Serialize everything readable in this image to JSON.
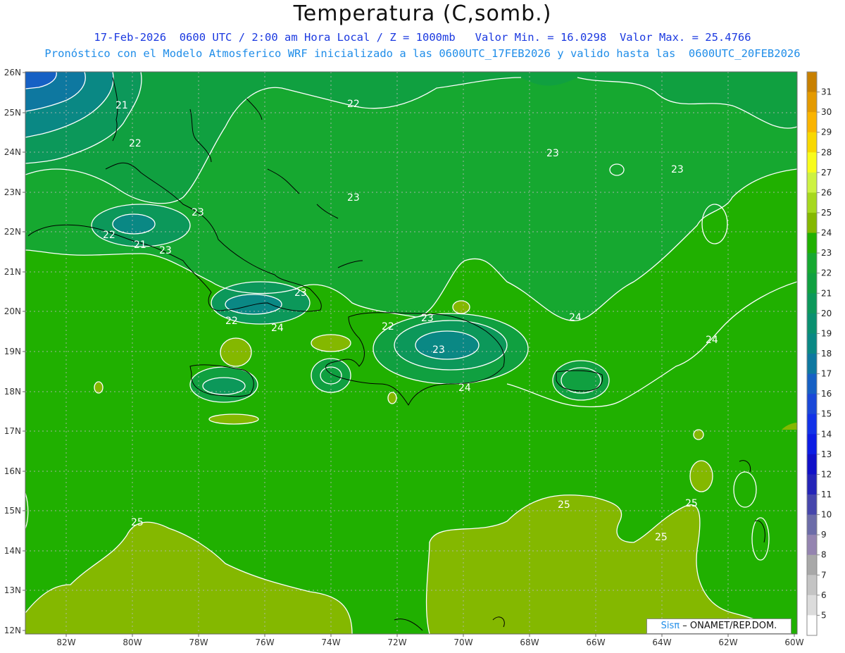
{
  "header": {
    "title": "Temperatura (C,somb.)",
    "line1": "17-Feb-2026  0600 UTC / 2:00 am Hora Local / Z = 1000mb   Valor Min. = 16.0298  Valor Max. = 25.4766",
    "line2": "Pronóstico con el Modelo Atmosferico WRF inicializado a las 0600UTC_17FEB2026 y valido hasta las  0600UTC_20FEB2026"
  },
  "axes": {
    "lat_labels": [
      "26N",
      "25N",
      "24N",
      "23N",
      "22N",
      "21N",
      "20N",
      "19N",
      "18N",
      "17N",
      "16N",
      "15N",
      "14N",
      "13N",
      "12N"
    ],
    "lon_labels": [
      "82W",
      "80W",
      "78W",
      "76W",
      "74W",
      "72W",
      "70W",
      "68W",
      "66W",
      "64W",
      "62W",
      "60W"
    ]
  },
  "colorbar": {
    "levels": [
      "31",
      "30",
      "29",
      "28",
      "27",
      "26",
      "25",
      "24",
      "23",
      "22",
      "21",
      "20",
      "19",
      "18",
      "17",
      "16",
      "15",
      "14",
      "13",
      "12",
      "11",
      "10",
      "9",
      "8",
      "7",
      "6",
      "5"
    ],
    "colors": [
      "#c88000",
      "#e49a00",
      "#fab400",
      "#f8d800",
      "#f8fc1c",
      "#cdf242",
      "#a6d81e",
      "#84b800",
      "#20b000",
      "#16a830",
      "#10a040",
      "#0c985a",
      "#0a9070",
      "#0a8884",
      "#0e78a0",
      "#1660c4",
      "#1a48d8",
      "#1232e8",
      "#0c1ce4",
      "#1010c8",
      "#2424b8",
      "#4646ac",
      "#6c6ca8",
      "#9484b0",
      "#a8a8a8",
      "#c4c4c4",
      "#dcdcdc",
      "#ffffff"
    ]
  },
  "contour_labels": [
    "21",
    "22",
    "22",
    "22",
    "21",
    "23",
    "23",
    "23",
    "23",
    "22",
    "24",
    "22",
    "23",
    "23",
    "24",
    "24",
    "24",
    "23",
    "23",
    "25",
    "25",
    "25",
    "25"
  ],
  "credit": {
    "sis": "Sisπ",
    "text": "– ONAMET/REP.DOM."
  }
}
